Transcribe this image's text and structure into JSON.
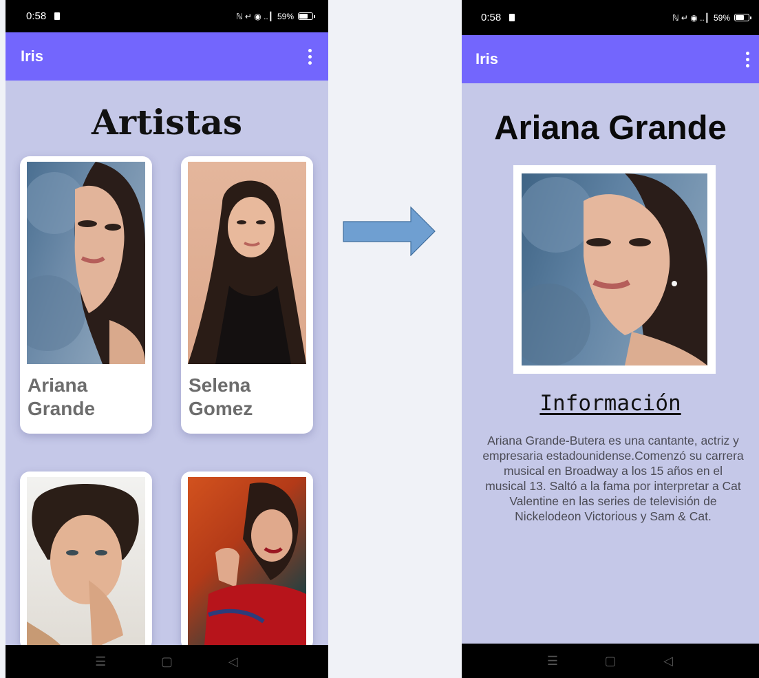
{
  "left_screen": {
    "status": {
      "time": "0:58",
      "icons": "ℕ ↵ ◉ ..┃",
      "battery": "59%"
    },
    "app_bar": {
      "title": "Iris"
    },
    "heading": "Artistas",
    "cards": [
      {
        "name": "Ariana Grande"
      },
      {
        "name": "Selena Gomez"
      }
    ]
  },
  "right_screen": {
    "status": {
      "time": "0:58",
      "icons": "ℕ ↵ ◉ ..┃",
      "battery": "59%"
    },
    "app_bar": {
      "title": "Iris"
    },
    "title": "Ariana Grande",
    "info_heading": "Información",
    "info_text": "Ariana Grande-Butera es una cantante, actriz y empresaria estadounidense.Comenzó su carrera musical en Broadway a los 15 años en el musical 13. Saltó a la fama por interpretar a Cat Valentine en las series de televisión de Nickelodeon Victorious y Sam & Cat."
  },
  "nav": {
    "menu_icon": "☰",
    "home_icon": "▢",
    "back_icon": "◁"
  },
  "colors": {
    "app_bar": "#7366fd",
    "screen_bg": "#c5c8e8",
    "arrow": "#6f9fd1"
  },
  "icons": [
    "overflow-menu-icon",
    "nfc-icon",
    "mute-icon",
    "wifi-icon",
    "signal-icon",
    "battery-icon",
    "right-arrow-icon"
  ]
}
